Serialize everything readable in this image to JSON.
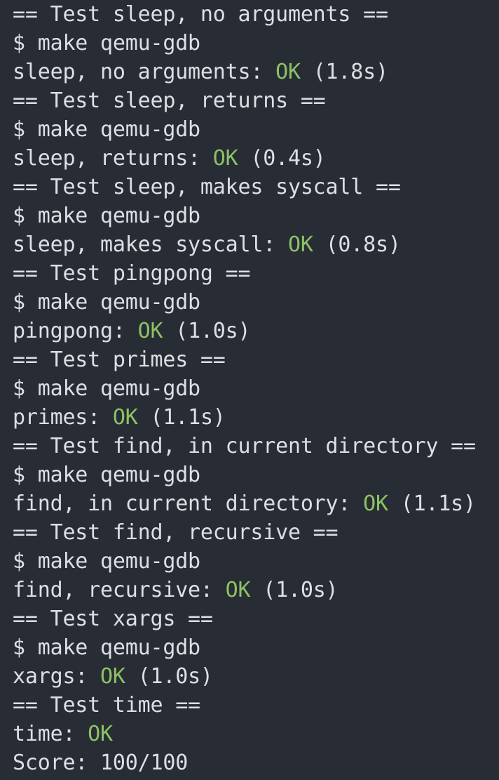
{
  "terminal": {
    "lines": [
      {
        "kind": "header",
        "text": "== Test sleep, no arguments =="
      },
      {
        "kind": "cmd",
        "text": "$ make qemu-gdb"
      },
      {
        "kind": "result",
        "pre": "sleep, no arguments: ",
        "status": "OK",
        "post": " (1.8s)"
      },
      {
        "kind": "header",
        "text": "== Test sleep, returns =="
      },
      {
        "kind": "cmd",
        "text": "$ make qemu-gdb"
      },
      {
        "kind": "result",
        "pre": "sleep, returns: ",
        "status": "OK",
        "post": " (0.4s)"
      },
      {
        "kind": "header",
        "text": "== Test sleep, makes syscall =="
      },
      {
        "kind": "cmd",
        "text": "$ make qemu-gdb"
      },
      {
        "kind": "result",
        "pre": "sleep, makes syscall: ",
        "status": "OK",
        "post": " (0.8s)"
      },
      {
        "kind": "header",
        "text": "== Test pingpong =="
      },
      {
        "kind": "cmd",
        "text": "$ make qemu-gdb"
      },
      {
        "kind": "result",
        "pre": "pingpong: ",
        "status": "OK",
        "post": " (1.0s)"
      },
      {
        "kind": "header",
        "text": "== Test primes =="
      },
      {
        "kind": "cmd",
        "text": "$ make qemu-gdb"
      },
      {
        "kind": "result",
        "pre": "primes: ",
        "status": "OK",
        "post": " (1.1s)"
      },
      {
        "kind": "header",
        "text": "== Test find, in current directory =="
      },
      {
        "kind": "cmd",
        "text": "$ make qemu-gdb"
      },
      {
        "kind": "result",
        "pre": "find, in current directory: ",
        "status": "OK",
        "post": " (1.1s)"
      },
      {
        "kind": "header",
        "text": "== Test find, recursive =="
      },
      {
        "kind": "cmd",
        "text": "$ make qemu-gdb"
      },
      {
        "kind": "result",
        "pre": "find, recursive: ",
        "status": "OK",
        "post": " (1.0s)"
      },
      {
        "kind": "header",
        "text": "== Test xargs =="
      },
      {
        "kind": "cmd",
        "text": "$ make qemu-gdb"
      },
      {
        "kind": "result",
        "pre": "xargs: ",
        "status": "OK",
        "post": " (1.0s)"
      },
      {
        "kind": "header",
        "text": "== Test time =="
      },
      {
        "kind": "result",
        "pre": "time: ",
        "status": "OK",
        "post": ""
      },
      {
        "kind": "score",
        "text": "Score: 100/100"
      }
    ]
  },
  "colors": {
    "background": "#282c34",
    "foreground": "#dcdfe4",
    "ok": "#8cc265"
  }
}
